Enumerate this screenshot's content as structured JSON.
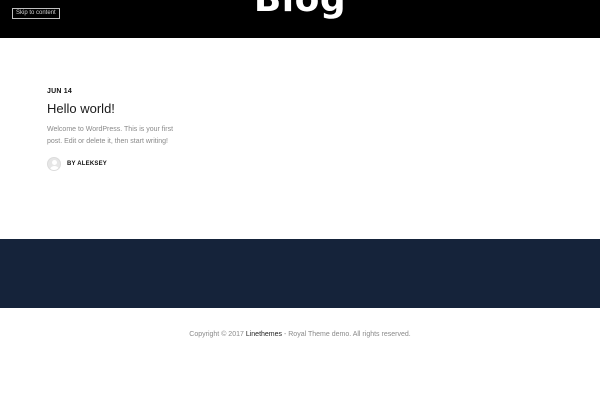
{
  "header": {
    "skip_link": "Skip to content",
    "title": "Blog"
  },
  "post": {
    "date": "JUN 14",
    "title": "Hello world!",
    "excerpt": "Welcome to WordPress. This is your first post. Edit or delete it, then start writing!",
    "author": "BY ALEKSEY"
  },
  "footer": {
    "copyright_prefix": "Copyright © 2017 ",
    "brand": "Linethemes",
    "copyright_suffix": " - Royal Theme demo. All rights reserved."
  },
  "colors": {
    "header_bg": "#000000",
    "footer_band": "#15233a",
    "text_muted": "#8a8a8a"
  }
}
